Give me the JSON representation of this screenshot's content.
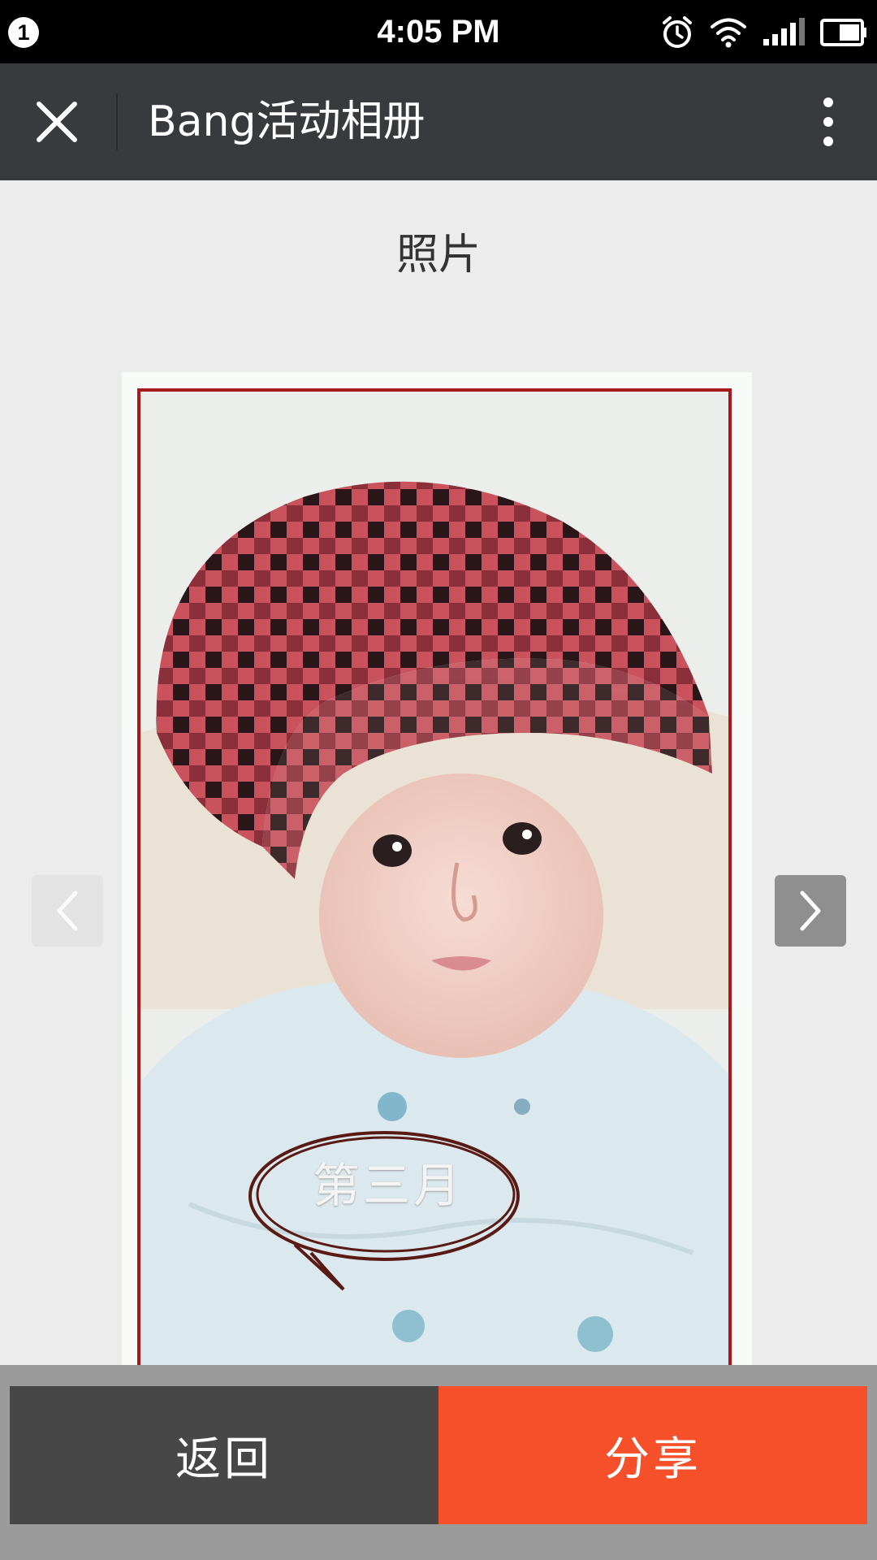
{
  "status_bar": {
    "notification_count": "1",
    "time": "4:05 PM",
    "icons": [
      "alarm-icon",
      "wifi-icon",
      "signal-icon",
      "battery-icon"
    ]
  },
  "action_bar": {
    "title": "Bang活动相册",
    "close_icon": "close-icon",
    "more_icon": "more-vertical-icon"
  },
  "page": {
    "heading": "照片",
    "photo": {
      "caption_in_image": "第三月"
    },
    "prev_icon": "chevron-left-icon",
    "next_icon": "chevron-right-icon"
  },
  "bottom_bar": {
    "back_label": "返回",
    "share_label": "分享"
  },
  "colors": {
    "status_bar": "#000000",
    "action_bar": "#393a3e",
    "page_background": "#ececec",
    "back_button": "#474747",
    "share_button": "#f5502a",
    "photo_border": "#a8191e"
  }
}
